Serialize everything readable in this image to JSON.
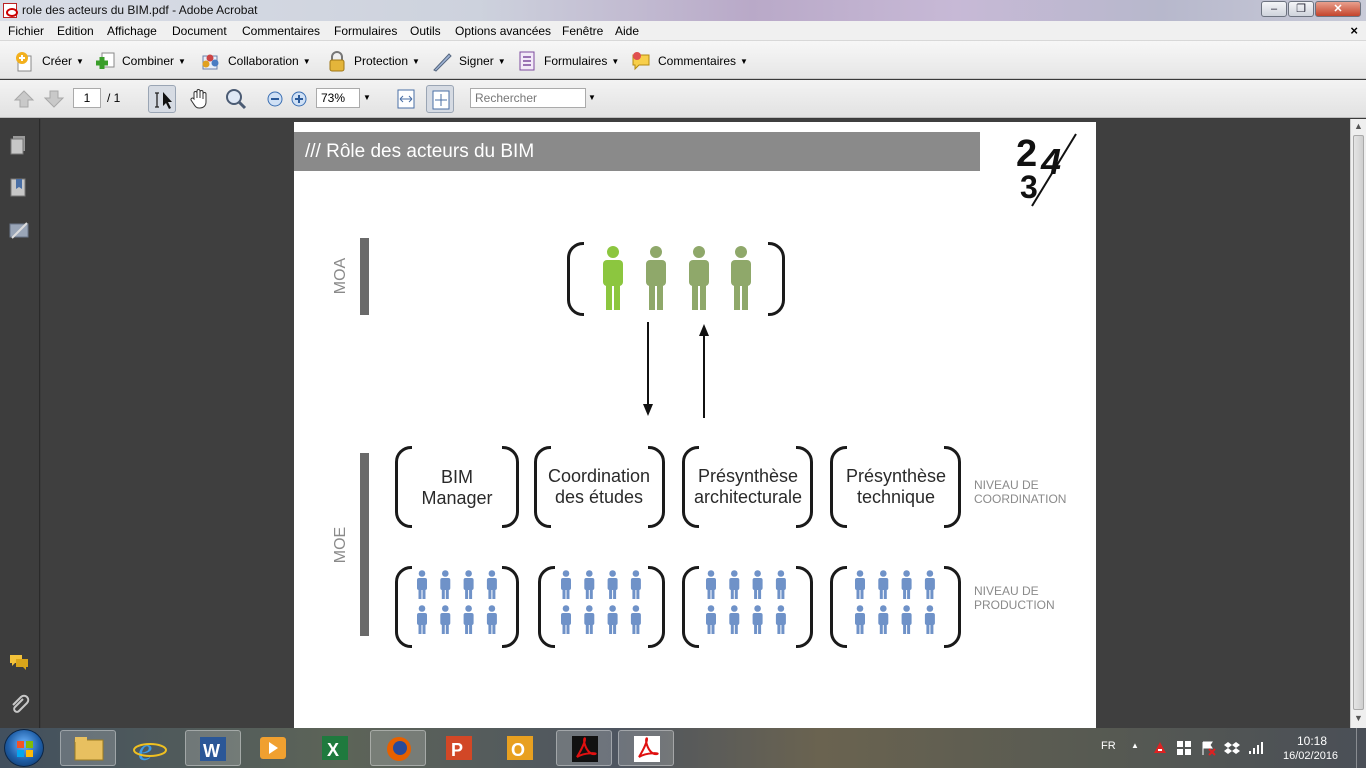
{
  "window": {
    "title": "role des acteurs du BIM.pdf - Adobe Acrobat",
    "buttons": [
      "minimize",
      "maximize",
      "close"
    ]
  },
  "menubar": {
    "items": [
      "Fichier",
      "Edition",
      "Affichage",
      "Document",
      "Commentaires",
      "Formulaires",
      "Outils",
      "Options avancées",
      "Fenêtre",
      "Aide"
    ],
    "close_doc": "×"
  },
  "task_toolbar": {
    "items": [
      {
        "label": "Créer",
        "icon": "create-icon"
      },
      {
        "label": "Combiner",
        "icon": "combine-icon"
      },
      {
        "label": "Collaboration",
        "icon": "collaboration-icon"
      },
      {
        "label": "Protection",
        "icon": "lock-icon"
      },
      {
        "label": "Signer",
        "icon": "pen-icon"
      },
      {
        "label": "Formulaires",
        "icon": "form-icon"
      },
      {
        "label": "Commentaires",
        "icon": "comment-icon"
      }
    ]
  },
  "nav_toolbar": {
    "current_page": "1",
    "page_count": "/ 1",
    "zoom": "73%",
    "search_placeholder": "Rechercher"
  },
  "slide": {
    "header": "/// Rôle des acteurs du BIM",
    "logo_text": "234",
    "moa_label": "MOA",
    "moe_label": "MOE",
    "coordination_boxes": [
      "BIM\nManager",
      "Coordination\ndes études",
      "Présynthèse\narchitecturale",
      "Présynthèse\ntechnique"
    ],
    "level_coordination": "NIVEAU DE\nCOORDINATION",
    "level_production": "NIVEAU DE\nPRODUCTION",
    "colors": {
      "moa_highlight": "#8cc63f",
      "moa_person": "#8fa86a",
      "moe_person": "#6f92c8",
      "header_bg": "#8a8a8a"
    }
  },
  "taskbar": {
    "apps": [
      "explorer",
      "internet-explorer",
      "word",
      "media-player",
      "excel",
      "firefox",
      "powerpoint",
      "outlook",
      "acrobat",
      "acrobat-reader"
    ],
    "language": "FR",
    "time": "10:18",
    "date": "16/02/2016"
  }
}
